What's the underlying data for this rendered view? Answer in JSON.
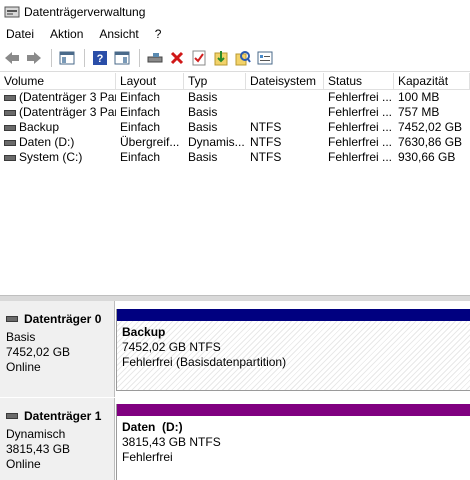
{
  "window": {
    "title": "Datenträgerverwaltung",
    "icon": "disk-management-icon"
  },
  "menu": [
    "Datei",
    "Aktion",
    "Ansicht",
    "?"
  ],
  "toolbar": {
    "buttons": [
      "back-arrow-icon",
      "forward-arrow-icon",
      "console-tree-icon",
      "help-icon",
      "window-icon",
      "connect-drive-icon",
      "delete-icon",
      "checklist-icon",
      "import-icon",
      "search-icon",
      "properties-icon"
    ]
  },
  "volume_list": {
    "columns": [
      "Volume",
      "Layout",
      "Typ",
      "Dateisystem",
      "Status",
      "Kapazität"
    ],
    "rows": [
      [
        "(Datenträger 3 Par...",
        "Einfach",
        "Basis",
        "",
        "Fehlerfrei ...",
        "100 MB"
      ],
      [
        "(Datenträger 3 Par...",
        "Einfach",
        "Basis",
        "",
        "Fehlerfrei ...",
        "757 MB"
      ],
      [
        "Backup",
        "Einfach",
        "Basis",
        "NTFS",
        "Fehlerfrei ...",
        "7452,02 GB"
      ],
      [
        "Daten (D:)",
        "Übergreif...",
        "Dynamis...",
        "NTFS",
        "Fehlerfrei ...",
        "7630,86 GB"
      ],
      [
        "System (C:)",
        "Einfach",
        "Basis",
        "NTFS",
        "Fehlerfrei ...",
        "930,66 GB"
      ]
    ]
  },
  "disks": [
    {
      "name": "Datenträger 0",
      "type": "Basis",
      "size": "7452,02 GB",
      "state": "Online",
      "bar_color": "#000080",
      "partition": {
        "name": "Backup",
        "size_fs": "7452,02 GB NTFS",
        "status": "Fehlerfrei (Basisdatenpartition)"
      }
    },
    {
      "name": "Datenträger 1",
      "type": "Dynamisch",
      "size": "3815,43 GB",
      "state": "Online",
      "bar_color": "#800080",
      "partition": {
        "name": "Daten  (D:)",
        "size_fs": "3815,43 GB NTFS",
        "status": "Fehlerfrei"
      }
    }
  ]
}
